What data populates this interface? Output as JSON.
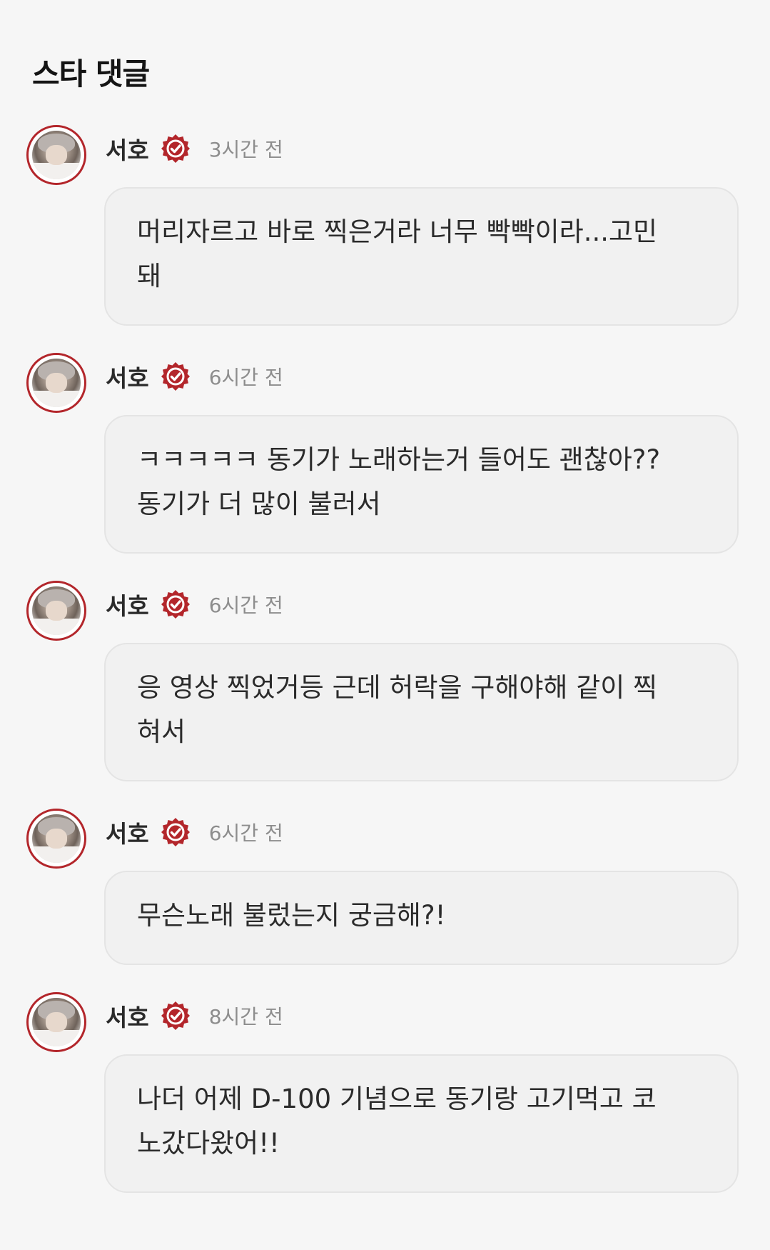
{
  "section": {
    "title": "스타 댓글"
  },
  "colors": {
    "badge": "#b3262b",
    "avatar_ring": "#b3262b",
    "bubble": "#f1f1f1",
    "background": "#f6f6f6"
  },
  "comments": [
    {
      "name": "서호",
      "badge_icon": "verified-badge-icon",
      "time": "3시간 전",
      "text": "머리자르고 바로 찍은거라 너무 빡빡이라...고민\n돼"
    },
    {
      "name": "서호",
      "badge_icon": "verified-badge-icon",
      "time": "6시간 전",
      "text": "ㅋㅋㅋㅋㅋ 동기가 노래하는거 들어도 괜찮아??\n동기가 더 많이 불러서"
    },
    {
      "name": "서호",
      "badge_icon": "verified-badge-icon",
      "time": "6시간 전",
      "text": "응 영상 찍었거등 근데 허락을 구해야해 같이 찍\n혀서"
    },
    {
      "name": "서호",
      "badge_icon": "verified-badge-icon",
      "time": "6시간 전",
      "text": "무슨노래 불렀는지 궁금해?!"
    },
    {
      "name": "서호",
      "badge_icon": "verified-badge-icon",
      "time": "8시간 전",
      "text": "나더 어제 D-100 기념으로 동기랑 고기먹고 코\n노갔다왔어!!"
    }
  ]
}
